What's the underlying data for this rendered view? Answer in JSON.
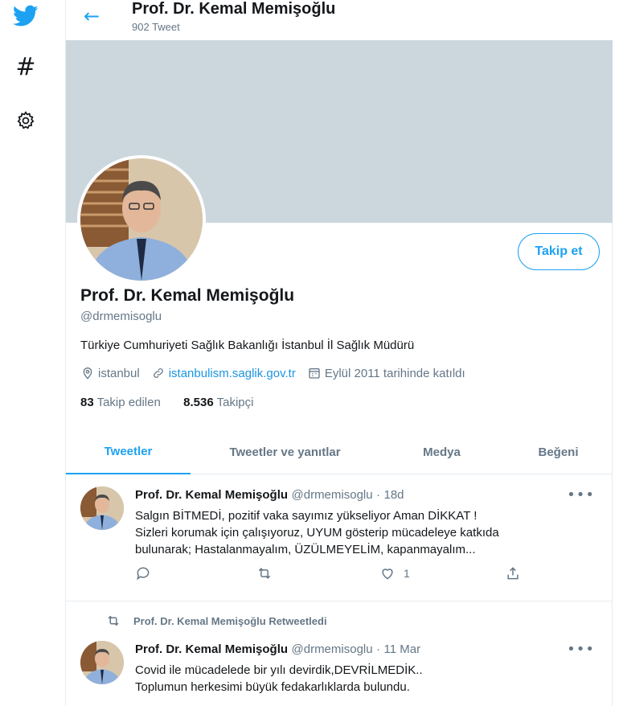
{
  "header": {
    "name": "Prof. Dr. Kemal Memişoğlu",
    "tweet_count": "902 Tweet"
  },
  "profile": {
    "name": "Prof. Dr. Kemal Memişoğlu",
    "handle": "@drmemisoglu",
    "bio": "Türkiye Cumhuriyeti Sağlık Bakanlığı İstanbul İl Sağlık Müdürü",
    "location": "istanbul",
    "website": "istanbulism.saglik.gov.tr",
    "joined": "Eylül 2011 tarihinde katıldı",
    "following_count": "83",
    "following_label": "Takip edilen",
    "followers_count": "8.536",
    "followers_label": "Takipçi",
    "follow_button": "Takip et"
  },
  "tabs": [
    "Tweetler",
    "Tweetler ve yanıtlar",
    "Medya",
    "Beğeni"
  ],
  "tweets": [
    {
      "name": "Prof. Dr. Kemal Memişoğlu",
      "handle": "@drmemisoglu",
      "time": "18d",
      "lines": [
        "Salgın BİTMEDİ,  pozitif vaka sayımız yükseliyor Aman DİKKAT !",
        "Sizleri korumak için çalışıyoruz, UYUM gösterip mücadeleye katkıda",
        "bulunarak; Hastalanmayalım, ÜZÜLMEYELİM, kapanmayalım..."
      ],
      "likes": "1"
    },
    {
      "retweeted_by": "Prof. Dr. Kemal Memişoğlu Retweetledi",
      "name": "Prof. Dr. Kemal Memişoğlu",
      "handle": "@drmemisoglu",
      "time": "11 Mar",
      "lines": [
        "Covid ile mücadelede bir yılı devirdik,DEVRİLMEDİK..",
        "Toplumun herkesimi büyük fedakarlıklarda bulundu."
      ]
    }
  ],
  "colors": {
    "accent": "#1da1f2",
    "banner": "#ccd6dd",
    "muted": "#657786"
  }
}
